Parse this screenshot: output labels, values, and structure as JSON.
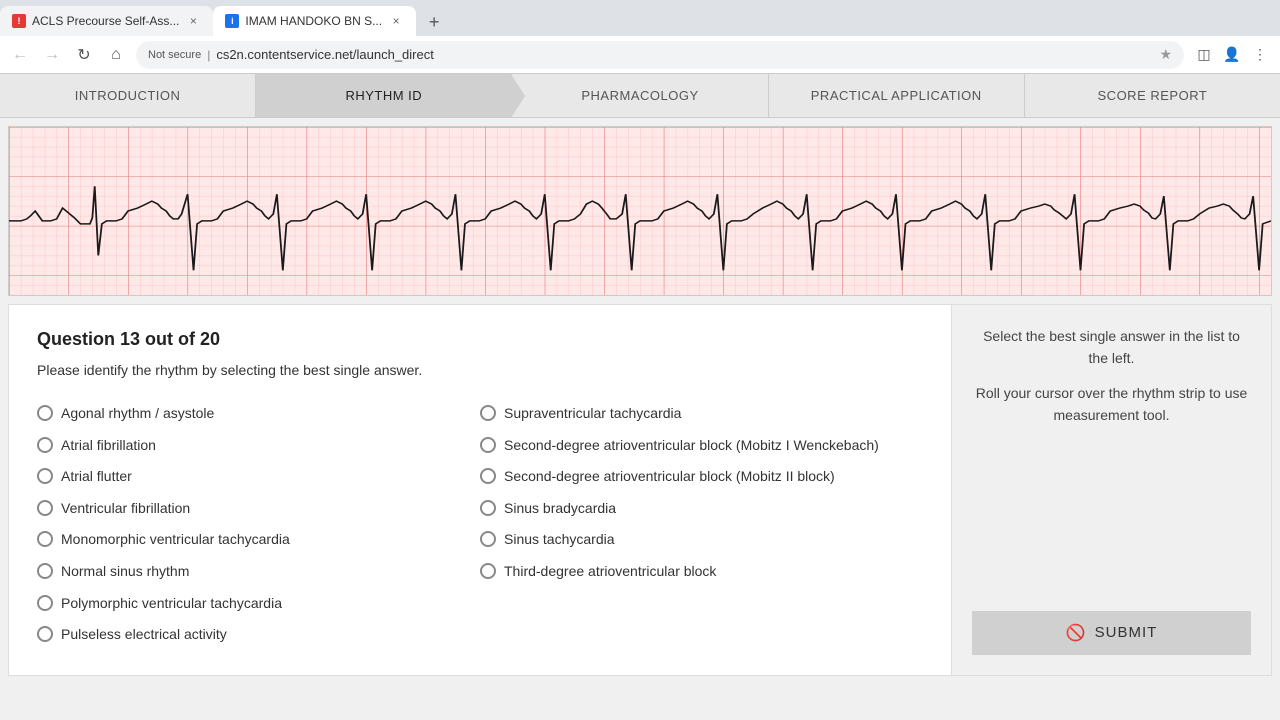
{
  "browser": {
    "tabs": [
      {
        "id": "tab-acls",
        "label": "ACLS Precourse Self-Ass...",
        "favicon_type": "acls",
        "favicon_text": "!",
        "active": false
      },
      {
        "id": "tab-imam",
        "label": "IMAM HANDOKO BN S...",
        "favicon_type": "imam",
        "favicon_text": "i",
        "active": true
      }
    ],
    "address": {
      "secure_label": "Not secure",
      "url": "cs2n.contentservice.net/launch_direct"
    }
  },
  "nav": {
    "tabs": [
      {
        "id": "introduction",
        "label": "INTRODUCTION",
        "active": false
      },
      {
        "id": "rhythm-id",
        "label": "RHYTHM ID",
        "active": true
      },
      {
        "id": "pharmacology",
        "label": "PHARMACOLOGY",
        "active": false
      },
      {
        "id": "practical-application",
        "label": "PRACTICAL APPLICATION",
        "active": false
      },
      {
        "id": "score-report",
        "label": "SCORE REPORT",
        "active": false
      }
    ]
  },
  "quiz": {
    "question_title": "Question 13 out of 20",
    "instruction": "Please identify the rhythm by selecting the best single answer.",
    "options_left": [
      {
        "id": "opt1",
        "label": "Agonal rhythm / asystole"
      },
      {
        "id": "opt2",
        "label": "Atrial fibrillation"
      },
      {
        "id": "opt3",
        "label": "Atrial flutter"
      },
      {
        "id": "opt4",
        "label": "Ventricular fibrillation"
      },
      {
        "id": "opt5",
        "label": "Monomorphic ventricular tachycardia"
      },
      {
        "id": "opt6",
        "label": "Normal sinus rhythm"
      },
      {
        "id": "opt7",
        "label": "Polymorphic ventricular tachycardia"
      },
      {
        "id": "opt8",
        "label": "Pulseless electrical activity"
      }
    ],
    "options_right": [
      {
        "id": "opt9",
        "label": "Supraventricular tachycardia"
      },
      {
        "id": "opt10",
        "label": "Second-degree atrioventricular block (Mobitz I Wenckebach)"
      },
      {
        "id": "opt11",
        "label": "Second-degree atrioventricular block (Mobitz II block)"
      },
      {
        "id": "opt12",
        "label": "Sinus bradycardia"
      },
      {
        "id": "opt13",
        "label": "Sinus tachycardia"
      },
      {
        "id": "opt14",
        "label": "Third-degree atrioventricular block"
      }
    ],
    "sidebar_text1": "Select the best single answer in the list to the left.",
    "sidebar_text2": "Roll your cursor over the rhythm strip to use measurement tool.",
    "submit_label": "SUBMIT"
  }
}
